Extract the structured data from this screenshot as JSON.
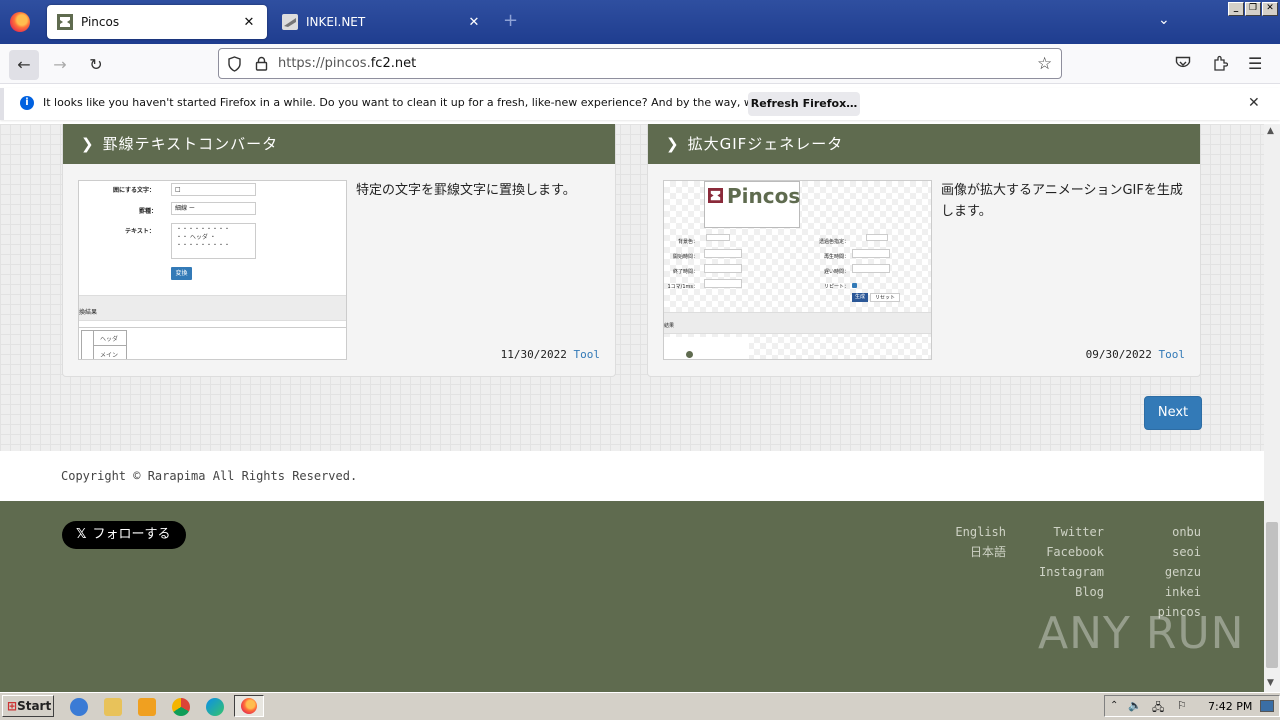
{
  "browser": {
    "tabs": [
      {
        "title": "Pincos",
        "active": true
      },
      {
        "title": "INKEI.NET",
        "active": false
      }
    ],
    "url_prefix": "https://pincos.",
    "url_host": "fc2.net",
    "window_buttons": [
      "_",
      "❐",
      "✕"
    ]
  },
  "notification": {
    "message": "It looks like you haven't started Firefox in a while. Do you want to clean it up for a fresh, like-new experience? And by the way, welcome back!",
    "button": "Refresh Firefox…"
  },
  "cards": [
    {
      "title": "罫線テキストコンバータ",
      "description": "特定の文字を罫線文字に置換します。",
      "date": "11/30/2022",
      "tag": "Tool",
      "thumb": {
        "label1": "囲にする文字：",
        "label2": "罫種：",
        "label3": "テキスト：",
        "select": "細線 ー",
        "text_sample": "ヘッダ",
        "button": "変換",
        "result_label": "換結果",
        "table_header": "ヘッダ",
        "table_cell": "メイン"
      }
    },
    {
      "title": "拡大GIFジェネレータ",
      "description": "画像が拡大するアニメーションGIFを生成します。",
      "date": "09/30/2022",
      "tag": "Tool",
      "thumb": {
        "logo": "Pincos",
        "labels_left": [
          "背景色：",
          "開始時間：",
          "終了時間：",
          "1コマ/1ms："
        ],
        "labels_right": [
          "透過色指定：",
          "再生時間：",
          "遅い時間：",
          "リピート："
        ],
        "btn_generate": "生成",
        "btn_reset": "リセット",
        "result_label": "結果"
      }
    }
  ],
  "pagination": {
    "next": "Next"
  },
  "copyright": "Copyright © Rarapima All Rights Reserved.",
  "footer": {
    "follow": "フォローする",
    "lang_links": [
      "English",
      "日本語"
    ],
    "social_links": [
      "Twitter",
      "Facebook",
      "Instagram",
      "Blog"
    ],
    "site_links": [
      "onbu",
      "seoi",
      "genzu",
      "inkei",
      "pincos"
    ]
  },
  "watermark": "ANY RUN",
  "taskbar": {
    "start": "Start",
    "clock": "7:42 PM"
  },
  "colors": {
    "header_green": "#5f6b4f",
    "link_blue": "#337ab7",
    "tab_strip": "#1f3d8f"
  }
}
